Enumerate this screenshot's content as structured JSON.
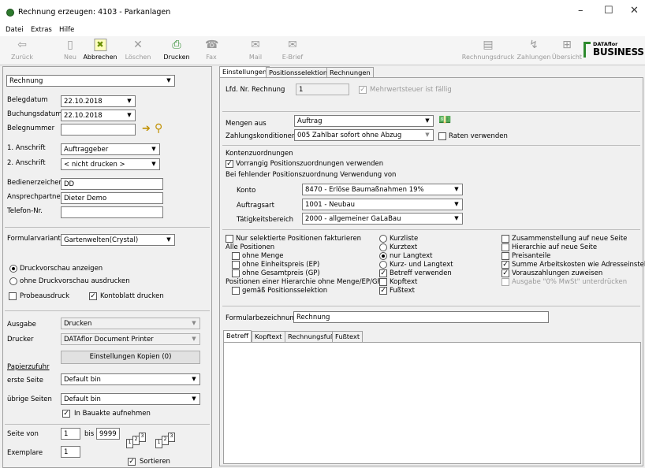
{
  "window": {
    "title": "Rechnung erzeugen: 4103 - Parkanlagen",
    "minimize": "–",
    "maximize": "☐",
    "close": "✕"
  },
  "menu": [
    "Datei",
    "Extras",
    "Hilfe"
  ],
  "toolbar": {
    "items": [
      {
        "label": "Zurück",
        "icon": "⇦"
      },
      {
        "label": "Neu",
        "icon": "▯"
      },
      {
        "label": "Abbrechen",
        "icon": "✖"
      },
      {
        "label": "Löschen",
        "icon": "✕"
      },
      {
        "label": "Drucken",
        "icon": "⎙"
      },
      {
        "label": "Fax",
        "icon": "☎"
      },
      {
        "label": "Mail",
        "icon": "✉"
      },
      {
        "label": "E-Brief",
        "icon": "✉"
      },
      {
        "label": "Rechnungsdruck",
        "icon": "▤"
      },
      {
        "label": "Zahlungen",
        "icon": "↯"
      },
      {
        "label": "Übersicht",
        "icon": "⊞"
      }
    ],
    "logo_top": "DATAflor",
    "logo_bottom": "BUSINESS"
  },
  "left": {
    "doctype": "Rechnung",
    "belegdatum_label": "Belegdatum",
    "belegdatum": "22.10.2018",
    "buchungsdatum_label": "Buchungsdatum",
    "buchungsdatum": "22.10.2018",
    "belegnummer_label": "Belegnummer",
    "belegnummer": "",
    "anschrift1_label": "1. Anschrift",
    "anschrift1": "Auftraggeber",
    "anschrift2_label": "2. Anschrift",
    "anschrift2": "< nicht drucken >",
    "bearbeiter_label": "Bedienerzeichen",
    "bearbeiter": "DD",
    "ansprechpartner_label": "Ansprechpartner",
    "ansprechpartner": "Dieter Demo",
    "telefon_label": "Telefon-Nr.",
    "telefon": "",
    "formularvariante_label": "Formularvariante",
    "formularvariante": "Gartenwelten(Crystal)",
    "druckvorschau_an": "Druckvorschau anzeigen",
    "druckvorschau_aus": "ohne Druckvorschau ausdrucken",
    "probeausdruck": "Probeausdruck",
    "kontoblatt": "Kontoblatt drucken",
    "ausgabe_label": "Ausgabe",
    "ausgabe": "Drucken",
    "drucker_label": "Drucker",
    "drucker": "DATAflor Document Printer",
    "kopien_button": "Einstellungen Kopien (0)",
    "papierzufuhr_label": "Papierzufuhr",
    "erste_seite_label": "erste Seite",
    "erste_seite": "Default bin",
    "uebrige_label": "übrige Seiten",
    "uebrige": "Default bin",
    "bauakte": "In Bauakte aufnehmen",
    "seite_von_label": "Seite von",
    "seite_von": "1",
    "bis_label": "bis",
    "bis": "9999",
    "exemplare_label": "Exemplare",
    "exemplare": "1",
    "sortieren": "Sortieren"
  },
  "tabs": [
    "Einstellungen",
    "Positionsselektion",
    "Rechnungen"
  ],
  "right": {
    "lfd_label": "Lfd. Nr. Rechnung",
    "lfd": "1",
    "mwst": "Mehrwertsteuer ist fällig",
    "mengen_label": "Mengen aus",
    "mengen": "Auftrag",
    "zahlung_label": "Zahlungskonditionen",
    "zahlung": "005 Zahlbar sofort ohne Abzug",
    "raten": "Raten verwenden",
    "konto_header": "Kontenzuordnungen",
    "vorrangig": "Vorrangig Positionszuordnungen verwenden",
    "fehlend": "Bei fehlender Positionszuordnung Verwendung von",
    "konto_label": "Konto",
    "konto": "8470 - Erlöse Baumaßnahmen 19%",
    "auftragsart_label": "Auftragsart",
    "auftragsart": "1001 - Neubau",
    "taetigkeit_label": "Tätigkeitsbereich",
    "taetigkeit": "2000 - allgemeiner GaLaBau",
    "col1": [
      {
        "label": "Nur selektierte Positionen fakturieren",
        "checked": false
      },
      {
        "label": "Alle Positionen",
        "plain": true
      },
      {
        "label": "ohne Menge",
        "checked": false
      },
      {
        "label": "ohne Einheitspreis (EP)",
        "checked": false
      },
      {
        "label": "ohne Gesamtpreis (GP)",
        "checked": false
      },
      {
        "label": "Positionen einer Hierarchie ohne Menge/EP/GP",
        "plain": true
      },
      {
        "label": "gemäß Positionsselektion",
        "checked": false
      }
    ],
    "col2": [
      {
        "label": "Kurzliste",
        "radio": true,
        "checked": false
      },
      {
        "label": "Kurztext",
        "radio": true,
        "checked": false
      },
      {
        "label": "nur Langtext",
        "radio": true,
        "checked": true
      },
      {
        "label": "Kurz- und Langtext",
        "radio": true,
        "checked": false
      },
      {
        "label": "Betreff verwenden",
        "checked": true
      },
      {
        "label": "Kopftext",
        "checked": false
      },
      {
        "label": "Fußtext",
        "checked": true
      }
    ],
    "col3": [
      {
        "label": "Zusammenstellung auf neue Seite",
        "checked": false
      },
      {
        "label": "Hierarchie auf neue Seite",
        "checked": false
      },
      {
        "label": "Preisanteile",
        "checked": false
      },
      {
        "label": "Summe Arbeitskosten wie Adresseinstellung",
        "checked": true
      },
      {
        "label": "Vorauszahlungen zuweisen",
        "checked": true
      },
      {
        "label": "Ausgabe \"0% MwSt\" unterdrücken",
        "checked": false,
        "disabled": true
      }
    ],
    "formularbez_label": "Formularbezeichnung",
    "formularbez": "Rechnung",
    "subtabs": [
      "Betreff",
      "Kopftext",
      "Rechnungsfuß",
      "Fußtext"
    ]
  }
}
